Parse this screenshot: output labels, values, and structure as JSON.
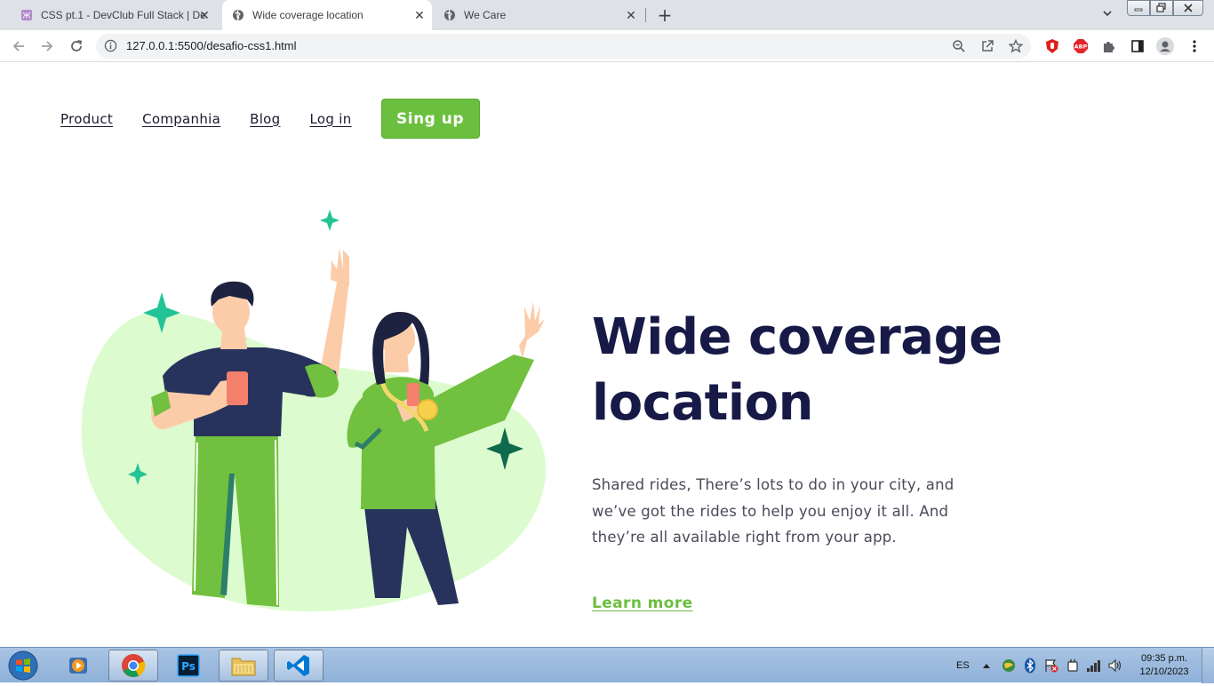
{
  "browser": {
    "tabs": [
      {
        "title": "CSS pt.1 - DevClub Full Stack | De",
        "active": false
      },
      {
        "title": "Wide coverage location",
        "active": true
      },
      {
        "title": "We Care",
        "active": false
      }
    ],
    "url": "127.0.0.1:5500/desafio-css1.html"
  },
  "nav": {
    "links": [
      "Product",
      "Companhia",
      "Blog",
      "Log in"
    ],
    "signup_label": "Sing up"
  },
  "hero": {
    "title_line1": "Wide coverage",
    "title_line2": "location",
    "description": "Shared rides, There’s lots to do in your city, and we’ve got the rides to help you enjoy it all. And they’re all available right from your app.",
    "learn_more": "Learn more"
  },
  "taskbar": {
    "language": "ES",
    "time": "09:35 p.m.",
    "date": "12/10/2023"
  },
  "colors": {
    "accent_green": "#6bbf3e",
    "title_navy": "#171a47",
    "blob_green": "#dcfccf",
    "sparkle_teal": "#1fbf8f"
  }
}
